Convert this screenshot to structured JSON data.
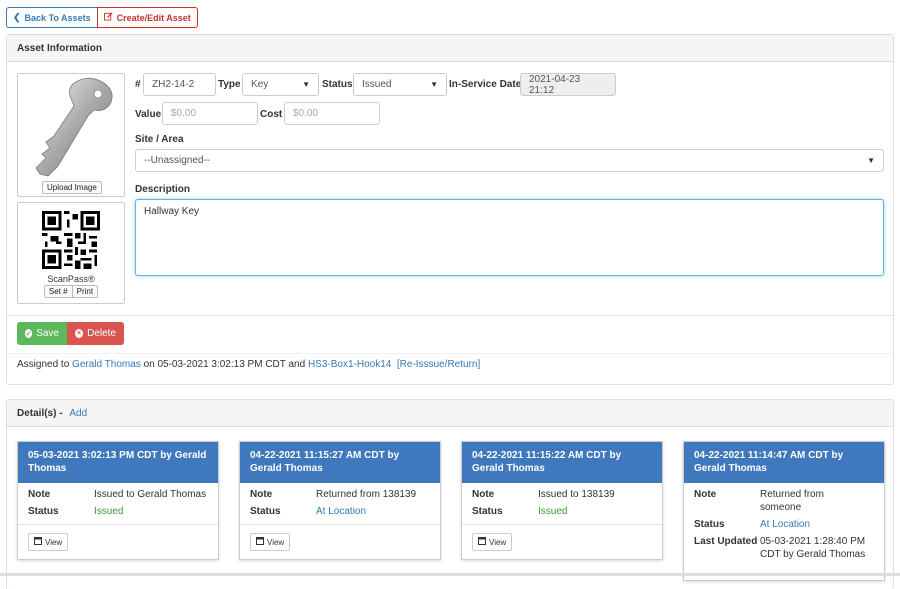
{
  "toolbar": {
    "back_label": "Back To Assets",
    "edit_label": "Create/Edit Asset"
  },
  "asset_panel": {
    "title": "Asset Information",
    "upload_image_label": "Upload Image",
    "scanpass_label": "ScanPass®",
    "set_number_label": "Set #",
    "print_label": "Print",
    "number_label": "#",
    "number_value": "ZH2-14-2",
    "type_label": "Type",
    "type_value": "Key",
    "status_label": "Status",
    "status_value": "Issued",
    "in_service_label": "In-Service Date",
    "in_service_value": "2021-04-23 21:12",
    "value_label": "Value",
    "value_placeholder": "$0.00",
    "cost_label": "Cost",
    "cost_placeholder": "$0.00",
    "site_label": "Site / Area",
    "site_value": "--Unassigned--",
    "description_label": "Description",
    "description_value": "Hallway Key",
    "save_label": "Save",
    "delete_label": "Delete",
    "assignment": {
      "prefix": "Assigned to",
      "person": "Gerald Thomas",
      "middle": "on 05-03-2021 3:02:13 PM CDT and",
      "location": "HS3-Box1-Hook14",
      "reissue_link": "[Re-Isssue/Return]"
    }
  },
  "details_panel": {
    "title": "Detail(s)",
    "separator": "-",
    "add_label": "Add",
    "cards": [
      {
        "header": "05-03-2021 3:02:13 PM CDT by Gerald Thomas",
        "note_label": "Note",
        "note_value": "Issued to Gerald Thomas",
        "status_label": "Status",
        "status_value": "Issued",
        "view_label": "View"
      },
      {
        "header": "04-22-2021 11:15:27 AM CDT by Gerald Thomas",
        "note_label": "Note",
        "note_value": "Returned from 138139",
        "status_label": "Status",
        "status_value": "At Location",
        "view_label": "View"
      },
      {
        "header": "04-22-2021 11:15:22 AM CDT by Gerald Thomas",
        "note_label": "Note",
        "note_value": "Issued to 138139",
        "status_label": "Status",
        "status_value": "Issued",
        "view_label": "View"
      },
      {
        "header": "04-22-2021 11:14:47 AM CDT by Gerald Thomas",
        "note_label": "Note",
        "note_value": "Returned from someone",
        "status_label": "Status",
        "status_value": "At Location",
        "updated_label": "Last Updated",
        "updated_value": "05-03-2021 1:28:40 PM CDT by Gerald Thomas"
      }
    ]
  },
  "colors": {
    "primary": "#337ab7",
    "danger": "#d9534f",
    "success": "#5cb85c",
    "card_header": "#3f78bc",
    "status_green": "#3c9a3c"
  }
}
